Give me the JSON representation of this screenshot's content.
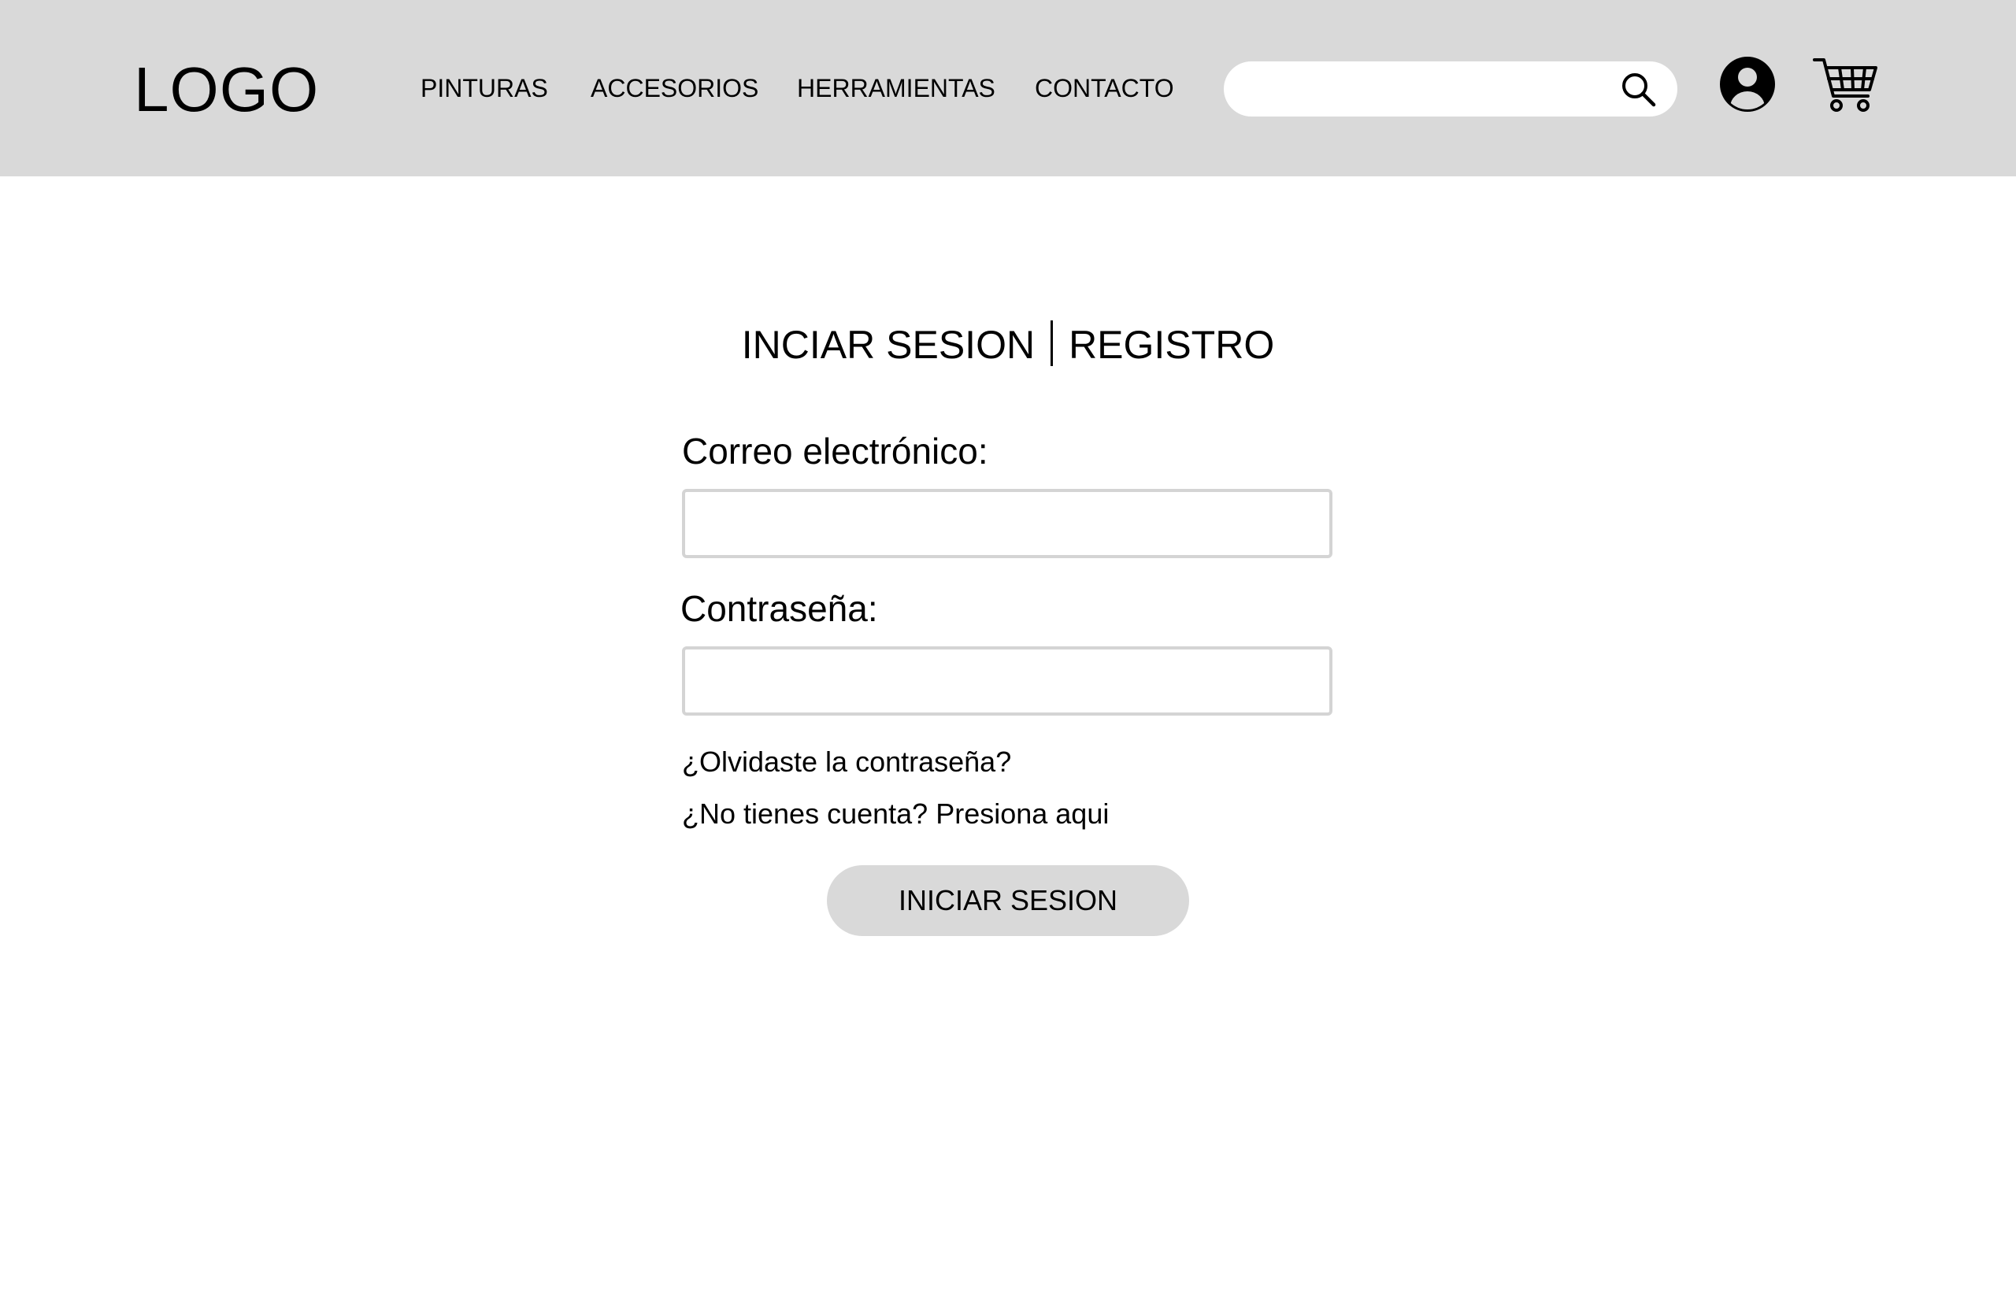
{
  "header": {
    "logo": "LOGO",
    "nav": [
      {
        "label": "PINTURAS"
      },
      {
        "label": "ACCESORIOS"
      },
      {
        "label": "HERRAMIENTAS"
      },
      {
        "label": "CONTACTO"
      }
    ],
    "search": {
      "value": "",
      "placeholder": ""
    },
    "icons": {
      "search": "search-icon",
      "account": "user-circle-icon",
      "cart": "shopping-cart-icon"
    }
  },
  "auth": {
    "tab_login": "INCIAR SESION",
    "tab_register": "REGISTRO",
    "email_label": "Correo electrónico:",
    "email_value": "",
    "password_label": "Contraseña:",
    "password_value": "",
    "forgot_link": "¿Olvidaste la contraseña?",
    "register_link": "¿No tienes cuenta? Presiona aqui",
    "submit_label": "INICIAR SESION"
  },
  "colors": {
    "header_bg": "#d9d9d9",
    "button_bg": "#d9d9d9",
    "field_border": "#d4d4d4",
    "text": "#000000"
  }
}
